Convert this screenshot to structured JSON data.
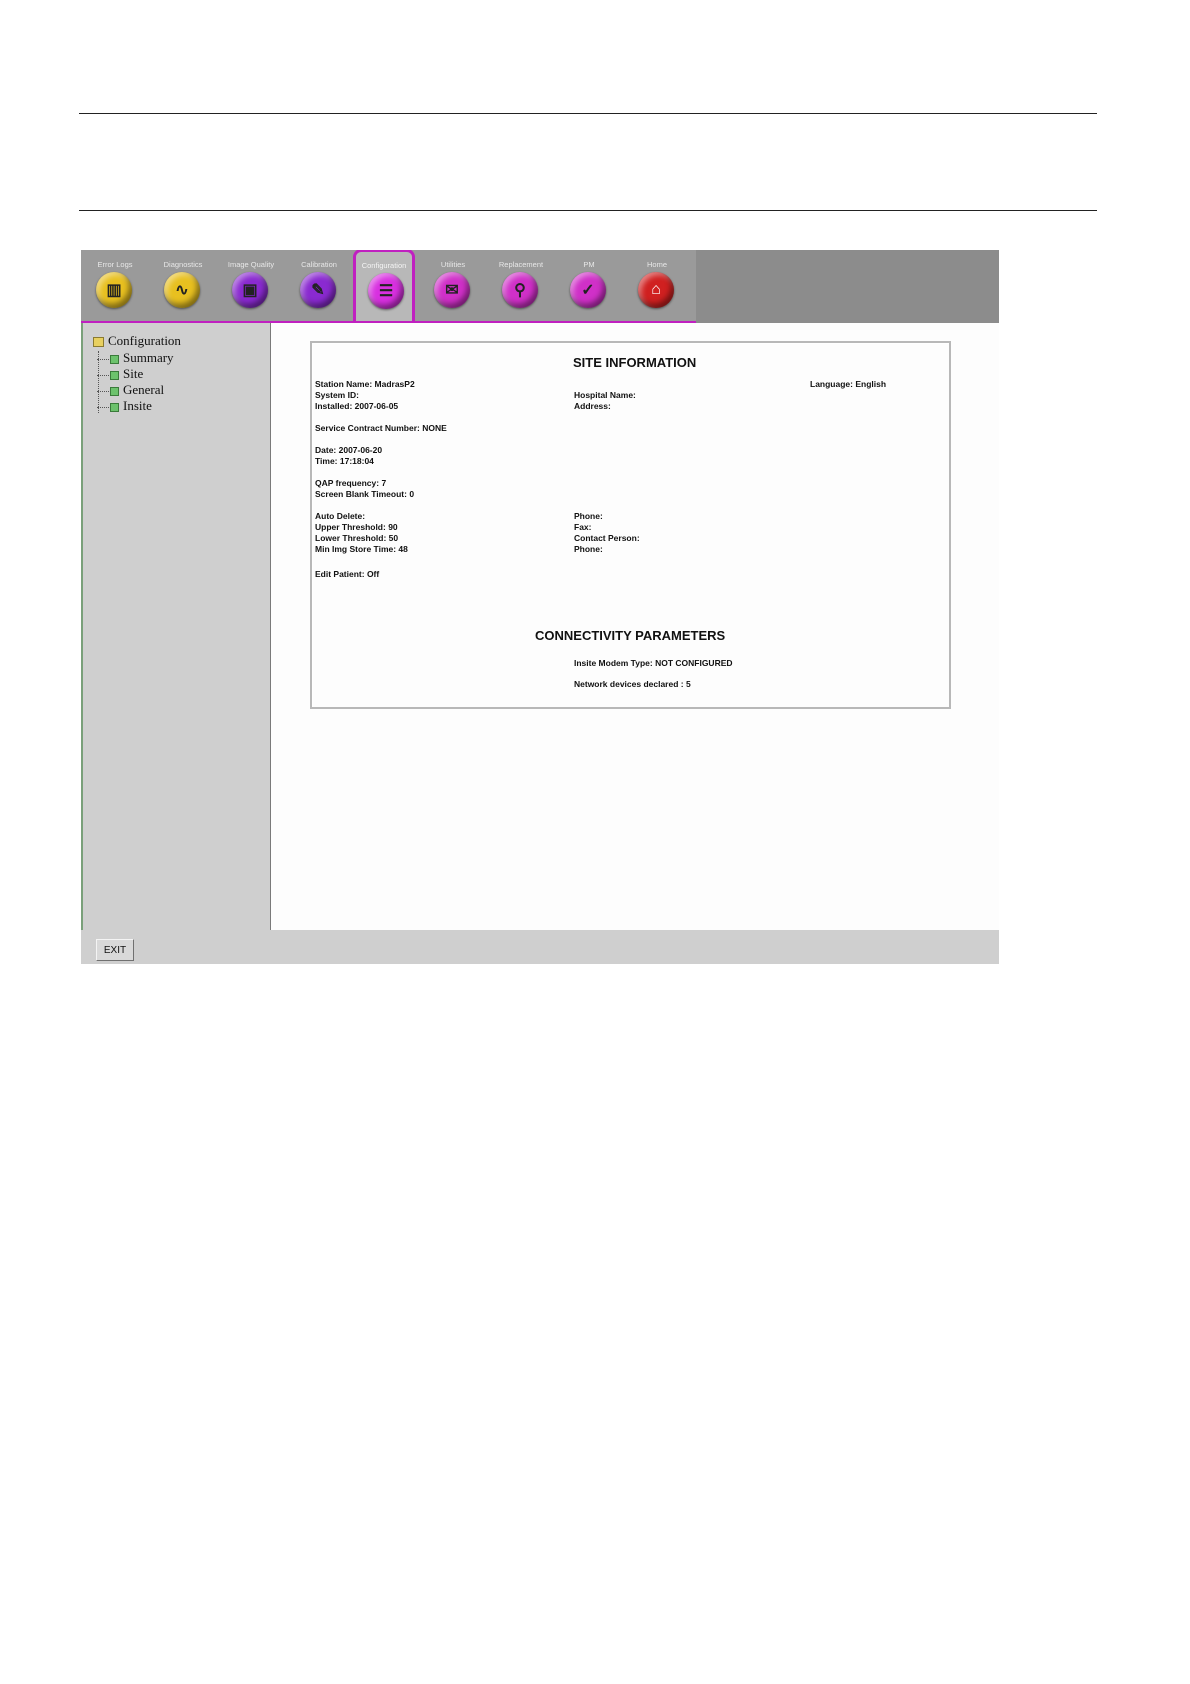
{
  "toolbar": {
    "tabs": [
      {
        "label": "Error Logs",
        "icon": "error-logs-icon",
        "color": "#e8c020",
        "glyph": "▥"
      },
      {
        "label": "Diagnostics",
        "icon": "stethoscope-icon",
        "color": "#e8c020",
        "glyph": "∿"
      },
      {
        "label": "Image Quality",
        "icon": "image-quality-icon",
        "color": "#8a2ad0",
        "glyph": "▣"
      },
      {
        "label": "Calibration",
        "icon": "calibration-icon",
        "color": "#8a2ad0",
        "glyph": "✎"
      },
      {
        "label": "Configuration",
        "icon": "configuration-icon",
        "color": "#d830e0",
        "glyph": "☰"
      },
      {
        "label": "Utilities",
        "icon": "utilities-icon",
        "color": "#d030c8",
        "glyph": "✉"
      },
      {
        "label": "Replacement",
        "icon": "replacement-icon",
        "color": "#d030c8",
        "glyph": "⚲"
      },
      {
        "label": "PM",
        "icon": "pm-icon",
        "color": "#d030c8",
        "glyph": "✓"
      },
      {
        "label": "Home",
        "icon": "home-icon",
        "color": "#d02020",
        "glyph": "⌂"
      }
    ],
    "active_tab": "Configuration"
  },
  "sidebar": {
    "root": "Configuration",
    "items": [
      {
        "label": "Summary"
      },
      {
        "label": "Site"
      },
      {
        "label": "General"
      },
      {
        "label": "Insite"
      }
    ]
  },
  "site": {
    "title": "SITE INFORMATION",
    "station_name": "Station Name: MadrasP2",
    "system_id": "System ID:",
    "installed": "Installed: 2007-06-05",
    "service_contract": "Service Contract Number: NONE",
    "date": "Date: 2007-06-20",
    "time": "Time: 17:18:04",
    "qap": "QAP frequency: 7",
    "screen_blank": "Screen Blank Timeout: 0",
    "auto_delete": "Auto Delete:",
    "upper_threshold": "Upper Threshold: 90",
    "lower_threshold": "Lower Threshold: 50",
    "min_img_store": "Min Img Store Time: 48",
    "edit_patient": "Edit Patient: Off",
    "hospital_name": "Hospital Name:",
    "address": "Address:",
    "phone": "Phone:",
    "fax": "Fax:",
    "contact_person": "Contact Person:",
    "phone2": "Phone:",
    "language": "Language: English"
  },
  "connectivity": {
    "title": "CONNECTIVITY PARAMETERS",
    "modem": "Insite Modem Type: NOT CONFIGURED",
    "network": "Network devices declared : 5"
  },
  "footer": {
    "exit_label": "EXIT"
  }
}
